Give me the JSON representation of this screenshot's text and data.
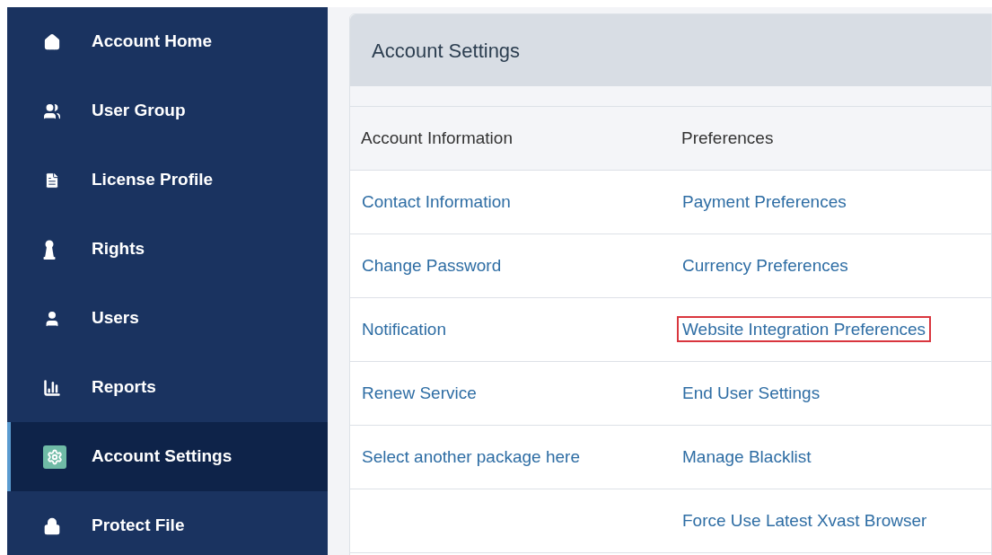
{
  "sidebar": {
    "items": [
      {
        "label": "Account Home",
        "selected": false
      },
      {
        "label": "User Group",
        "selected": false
      },
      {
        "label": "License Profile",
        "selected": false
      },
      {
        "label": "Rights",
        "selected": false
      },
      {
        "label": "Users",
        "selected": false
      },
      {
        "label": "Reports",
        "selected": false
      },
      {
        "label": "Account Settings",
        "selected": true
      },
      {
        "label": "Protect File",
        "selected": false
      }
    ]
  },
  "panel": {
    "title": "Account Settings",
    "table": {
      "columns": [
        "Account Information",
        "Preferences"
      ],
      "rows": [
        {
          "account_information": {
            "text": "Contact Information",
            "highlighted": false
          },
          "preferences": {
            "text": "Payment Preferences",
            "highlighted": false
          }
        },
        {
          "account_information": {
            "text": "Change Password",
            "highlighted": false
          },
          "preferences": {
            "text": "Currency Preferences",
            "highlighted": false
          }
        },
        {
          "account_information": {
            "text": "Notification",
            "highlighted": false
          },
          "preferences": {
            "text": "Website Integration Preferences",
            "highlighted": true
          }
        },
        {
          "account_information": {
            "text": "Renew Service",
            "highlighted": false
          },
          "preferences": {
            "text": "End User Settings",
            "highlighted": false
          }
        },
        {
          "account_information": {
            "text": "Select another package here",
            "highlighted": false
          },
          "preferences": {
            "text": "Manage Blacklist",
            "highlighted": false
          }
        },
        {
          "preferences": {
            "text": "Force Use Latest Xvast Browser",
            "highlighted": false
          }
        }
      ]
    }
  }
}
